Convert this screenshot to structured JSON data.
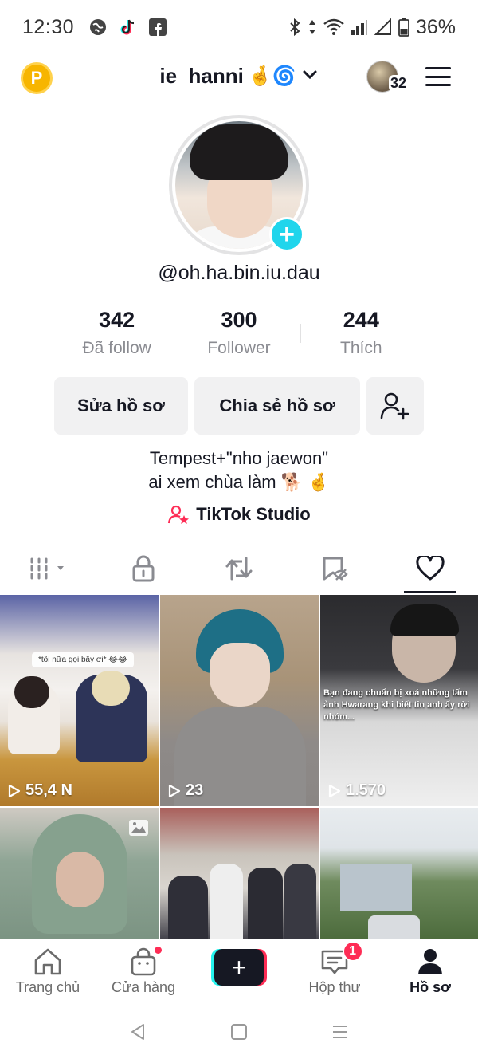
{
  "status_bar": {
    "time": "12:30",
    "battery": "36%",
    "left_icons": [
      "globe-icon",
      "tiktok-icon",
      "facebook-icon"
    ],
    "right_icons": [
      "bluetooth-icon",
      "data-arrows-icon",
      "wifi-icon",
      "signal-icon",
      "signal-empty-icon",
      "battery-icon"
    ]
  },
  "header": {
    "points_label": "P",
    "username": "ie_hanni",
    "username_emoji": "🤞🌀",
    "avatar_count": "32"
  },
  "profile": {
    "handle": "@oh.ha.bin.iu.dau",
    "add_badge": "+"
  },
  "stats": [
    {
      "value": "342",
      "label": "Đã follow"
    },
    {
      "value": "300",
      "label": "Follower"
    },
    {
      "value": "244",
      "label": "Thích"
    }
  ],
  "buttons": {
    "edit": "Sửa hồ sơ",
    "share": "Chia sẻ hồ sơ"
  },
  "bio": {
    "line1": "Tempest+\"nho jaewon\"",
    "line2": "ai xem chùa làm 🐕 🤞"
  },
  "studio_label": "TikTok Studio",
  "tabs": [
    "videos-grid-icon",
    "lock-icon",
    "repost-icon",
    "favorites-icon",
    "liked-heart-icon"
  ],
  "grid": [
    {
      "views": "55,4 N",
      "caption": "*tôi nữa gọi bây ơi* 😂😂"
    },
    {
      "views": "23"
    },
    {
      "views": "1.570",
      "overlay": "Bạn đang chuẩn bị xoá những tấm ảnh Hwarang khi biết tin anh ấy rời nhóm..."
    },
    {
      "views": ""
    },
    {
      "views": ""
    },
    {
      "views": ""
    }
  ],
  "bottom_nav": {
    "home": "Trang chủ",
    "shop": "Cửa hàng",
    "inbox": "Hộp thư",
    "inbox_badge": "1",
    "profile": "Hồ sơ"
  },
  "colors": {
    "accent_pink": "#fe2c55",
    "accent_cyan": "#25f4ee",
    "text_primary": "#161823",
    "text_secondary": "#8a8b91",
    "button_bg": "#f1f1f2"
  }
}
